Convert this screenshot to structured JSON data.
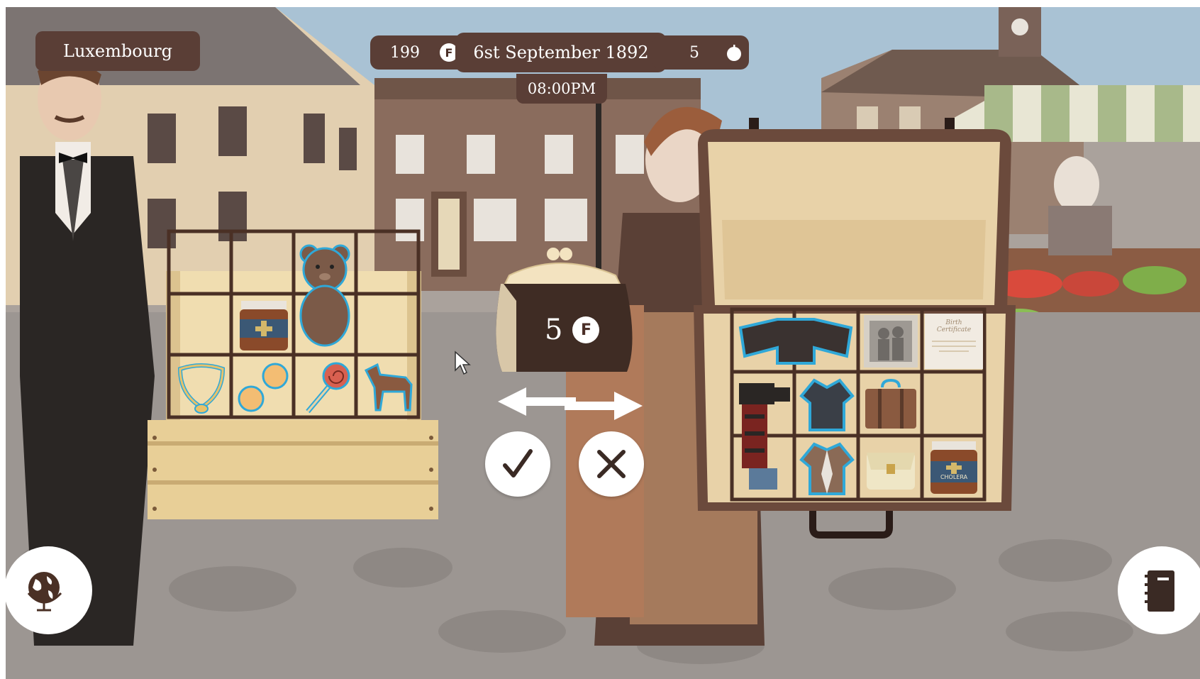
{
  "hud": {
    "location": "Luxembourg",
    "money": "199",
    "date": "6st September 1892",
    "time": "08:00PM",
    "food": "5",
    "money_icon": "franc-coin-icon",
    "food_icon": "apple-icon"
  },
  "trade": {
    "purse_amount": "5",
    "purse_icon": "franc-coin-icon",
    "swap_icon": "swap-arrows-icon",
    "accept_icon": "checkmark-icon",
    "reject_icon": "close-icon"
  },
  "crate_items": [
    "teddy-bear",
    "medicine-jar",
    "necklace",
    "coins",
    "lollipop",
    "toy-horse"
  ],
  "suitcase_items": [
    "coat",
    "family-photo",
    "birth-certificate",
    "sewing-machine",
    "jacket",
    "small-suitcase",
    "blazer",
    "satchel",
    "cholera-medicine"
  ],
  "suitcase_labels": {
    "certificate": "Birth Certificate",
    "medicine": "CHOLERA"
  },
  "buttons": {
    "map_icon": "globe-icon",
    "journal_icon": "notebook-icon"
  },
  "colors": {
    "hud_bg": "#5a3e36",
    "highlight": "#2fa8d8",
    "crate": "#e8cf97",
    "suitcase": "#6b4a3c"
  }
}
